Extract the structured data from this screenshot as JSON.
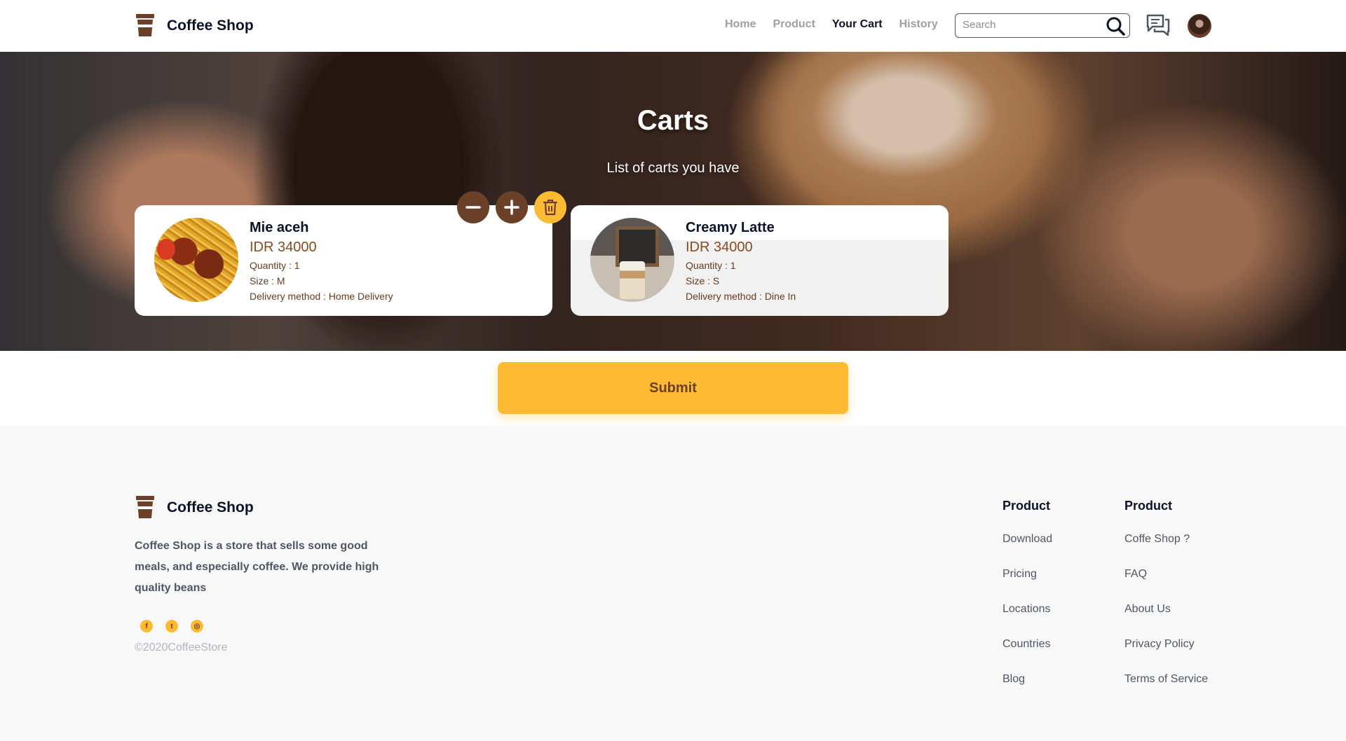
{
  "brand": {
    "name": "Coffee Shop",
    "icon": "coffee-cup-icon",
    "color": "#6a4029"
  },
  "nav": {
    "links": [
      "Home",
      "Product",
      "Your Cart",
      "History"
    ],
    "active": "Your Cart"
  },
  "search": {
    "placeholder": "Search",
    "value": ""
  },
  "hero": {
    "title": "Carts",
    "subtitle": "List of carts you have"
  },
  "carts": [
    {
      "name": "Mie aceh",
      "price": "IDR 34000",
      "quantity": "Quantity : 1",
      "size": "Size : M",
      "delivery": "Delivery method : Home Delivery"
    },
    {
      "name": "Creamy Latte",
      "price": "IDR 34000",
      "quantity": "Quantity : 1",
      "size": "Size : S",
      "delivery": "Delivery method : Dine In"
    }
  ],
  "cart_actions": [
    "minus-icon",
    "plus-icon",
    "trash-icon"
  ],
  "submit": {
    "label": "Submit"
  },
  "footer": {
    "brand": "Coffee Shop",
    "description": "Coffee Shop is a store that sells some good meals, and especially coffee. We provide high quality beans",
    "socials": [
      "facebook-icon",
      "twitter-icon",
      "instagram-icon"
    ],
    "copyright": "©2020CoffeeStore",
    "columns": [
      {
        "title": "Product",
        "links": [
          "Download",
          "Pricing",
          "Locations",
          "Countries",
          "Blog"
        ]
      },
      {
        "title": "Product",
        "links": [
          "Coffe Shop ?",
          "FAQ",
          "About Us",
          "Privacy Policy",
          "Terms of Service"
        ]
      }
    ]
  },
  "colors": {
    "accent": "#ffba33",
    "brown": "#6a4029",
    "dark": "#0b132a",
    "muted": "#4f5665"
  }
}
